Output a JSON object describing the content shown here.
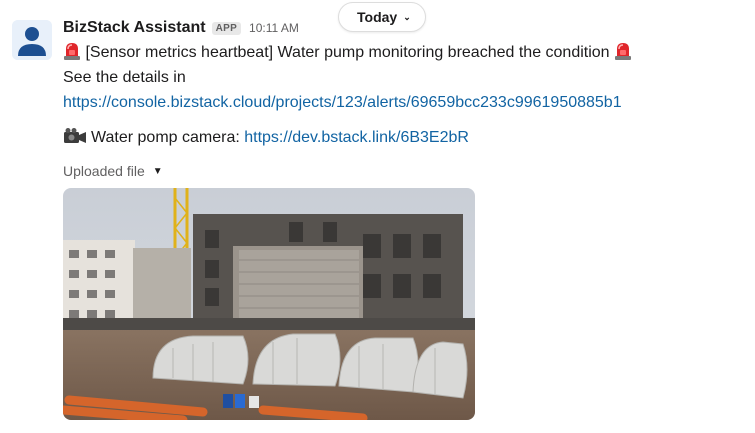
{
  "divider": {
    "label": "Today"
  },
  "message": {
    "sender": "BizStack Assistant",
    "badge": "APP",
    "time": "10:11 AM",
    "alert_text": "[Sensor metrics heartbeat] Water pump monitoring breached the condition",
    "details_prefix": "See the details in",
    "details_link": "https://console.bizstack.cloud/projects/123/alerts/69659bcc233c9961950885b1",
    "camera_label": "Water pomp camera: ",
    "camera_link": "https://dev.bstack.link/6B3E2bR",
    "uploaded_label": "Uploaded file"
  },
  "icons": {
    "alarm": "rotating-light-icon",
    "camera": "video-camera-icon",
    "caret": "caret-down-icon",
    "chevron": "chevron-down-icon"
  },
  "colors": {
    "link": "#1264a3",
    "muted": "#616061",
    "text": "#1d1c1d"
  }
}
